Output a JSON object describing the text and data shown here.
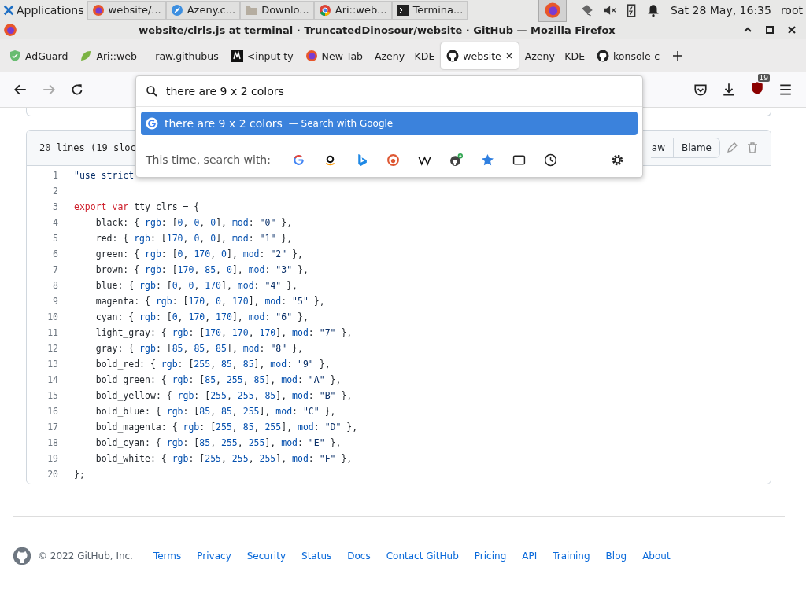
{
  "taskbar": {
    "menu": "Applications",
    "tasks": [
      {
        "label": "website/...",
        "selected": false
      },
      {
        "label": "Azeny.c...",
        "selected": false
      },
      {
        "label": "Downlo...",
        "selected": false
      },
      {
        "label": "Ari::web...",
        "selected": false
      },
      {
        "label": "Termina...",
        "selected": false
      }
    ],
    "clock": "Sat 28 May, 16:35",
    "user": "root"
  },
  "window": {
    "title": "website/clrls.js at terminal · TruncatedDinosour/website · GitHub — Mozilla Firefox"
  },
  "tabs": [
    {
      "label": "AdGuard",
      "selected": false
    },
    {
      "label": "Ari::web -",
      "selected": false
    },
    {
      "label": "raw.githubus",
      "selected": false
    },
    {
      "label": "<input ty",
      "selected": false
    },
    {
      "label": "New Tab",
      "selected": false
    },
    {
      "label": "Azeny - KDE",
      "selected": false
    },
    {
      "label": "website",
      "selected": true
    },
    {
      "label": "Azeny - KDE",
      "selected": false
    },
    {
      "label": "konsole-c",
      "selected": false
    }
  ],
  "toolbar": {
    "badge": "19"
  },
  "url_dropdown": {
    "query": "there are 9 x 2 colors",
    "suggestion": {
      "text": "there are 9 x 2 colors",
      "hint": "— Search with Google",
      "selected": true
    },
    "search_with_label": "This time, search with:"
  },
  "file": {
    "info": "20 lines (19 sloc",
    "buttons": [
      "aw",
      "Blame"
    ],
    "lines": [
      {
        "number": "1",
        "code": "\"use strict"
      },
      {
        "number": "2"
      },
      {
        "number": "3",
        "code": "export var tty_clrs = {"
      },
      {
        "number": "4",
        "code": "    black: { rgb: [0, 0, 0], mod: \"0\" },"
      },
      {
        "number": "5",
        "code": "    red: { rgb: [170, 0, 0], mod: \"1\" },"
      },
      {
        "number": "6",
        "code": "    green: { rgb: [0, 170, 0], mod: \"2\" },"
      },
      {
        "number": "7",
        "code": "    brown: { rgb: [170, 85, 0], mod: \"3\" },"
      },
      {
        "number": "8",
        "code": "    blue: { rgb: [0, 0, 170], mod: \"4\" },"
      },
      {
        "number": "9",
        "code": "    magenta: { rgb: [170, 0, 170], mod: \"5\" },"
      },
      {
        "number": "10",
        "code": "    cyan: { rgb: [0, 170, 170], mod: \"6\" },"
      },
      {
        "number": "11",
        "code": "    light_gray: { rgb: [170, 170, 170], mod: \"7\" },"
      },
      {
        "number": "12",
        "code": "    gray: { rgb: [85, 85, 85], mod: \"8\" },"
      },
      {
        "number": "13",
        "code": "    bold_red: { rgb: [255, 85, 85], mod: \"9\" },"
      },
      {
        "number": "14",
        "code": "    bold_green: { rgb: [85, 255, 85], mod: \"A\" },"
      },
      {
        "number": "15",
        "code": "    bold_yellow: { rgb: [255, 255, 85], mod: \"B\" },"
      },
      {
        "number": "16",
        "code": "    bold_blue: { rgb: [85, 85, 255], mod: \"C\" },"
      },
      {
        "number": "17",
        "code": "    bold_magenta: { rgb: [255, 85, 255], mod: \"D\" },"
      },
      {
        "number": "18",
        "code": "    bold_cyan: { rgb: [85, 255, 255], mod: \"E\" },"
      },
      {
        "number": "19",
        "code": "    bold_white: { rgb: [255, 255, 255], mod: \"F\" },"
      },
      {
        "number": "20",
        "code": "};"
      }
    ]
  },
  "footer": {
    "copyright": "© 2022 GitHub, Inc.",
    "links": [
      "Terms",
      "Privacy",
      "Security",
      "Status",
      "Docs",
      "Contact GitHub",
      "Pricing",
      "API",
      "Training",
      "Blog",
      "About"
    ]
  }
}
